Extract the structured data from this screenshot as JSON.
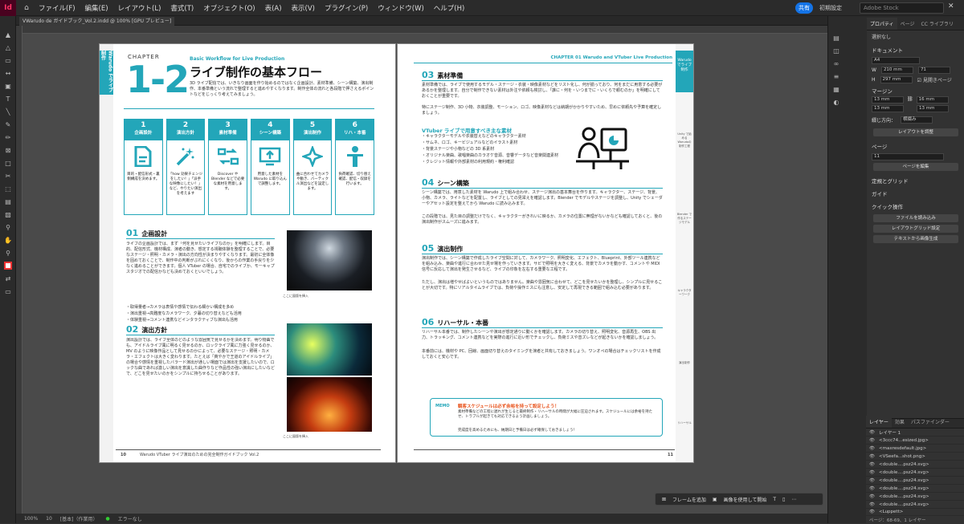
{
  "app": {
    "logo": "Id",
    "menu": [
      "ファイル(F)",
      "編集(E)",
      "レイアウト(L)",
      "書式(T)",
      "オブジェクト(O)",
      "表(A)",
      "表示(V)",
      "プラグイン(P)",
      "ウィンドウ(W)",
      "ヘルプ(H)"
    ],
    "share": "共有",
    "workspace": "初期設定",
    "search_placeholder": "Adobe Stock"
  },
  "document": {
    "tab": "VWarudo de ガイドブック_Vol.2.indd @ 100% [GPU プレビュー]"
  },
  "left_page": {
    "side_tab": "Warudo でライブ制作",
    "chapter": "CHAPTER",
    "number": "1-2",
    "subtitle": "Basic Workflow for Live Production",
    "title": "ライブ制作の基本フロー",
    "intro": "3D ライブ配信では、いきなり画面を作り始めるのではなく企画設計、素材準備、シーン構築、演出制作、本番準備という流れで整理すると進めやすくなります。制作全体の流れと各段階で押さえるポイントなどをじっくり考えてみましょう。",
    "steps": [
      {
        "n": "1",
        "t": "企画設計",
        "d": "目的・配信形式・裏側構成を決めます。"
      },
      {
        "n": "2",
        "t": "演出方針",
        "d": "「how 効果チェンジをしたい！」「派手な映像にしたい！」など、やりたい演出を考えます"
      },
      {
        "n": "3",
        "t": "素材準備",
        "d": "Discover や Blender などで必要な素材を用意します。"
      },
      {
        "n": "4",
        "t": "シーン構築",
        "d": "用意した素材を Warudo に取り込んで調整します。"
      },
      {
        "n": "5",
        "t": "演出制作",
        "d": "曲に合わせてカメラや動き、バーティクル演出などを設定します。"
      },
      {
        "n": "6",
        "t": "リハ・本番",
        "d": "負荷確認、切り替え確認、配信・収録を行います。"
      }
    ],
    "sec1": {
      "n": "01",
      "t": "企画設計",
      "body": "ライブの企画設計では、まず「何を見せたいライブなのか」を明確にします。目的、配信形式、機材構成、演者の動き、想定する視聴体験を整理することで、必要なステージ・照明・カメラ・演出の方向性が決まりやすくなります。最初に全体像を固めておくことで、制作中の判断がぶれにくくなり、後からの作業の手戻りを少なく進めることができます。個人 VTuber の場合、自宅でのライブか、モーキャプスタジオでの配信かなども決めておくといいでしょう。",
      "bullets": [
        "・取得量者→カメラは表情や感情で伝わる細かい構成を多め",
        "・演出重視→高難度なカメラワーク、夕暮の切り替えなども活用",
        "・体験重視→コメント連携などインタラクティブな演出も活用"
      ],
      "cap": "ここに図版を挿入"
    },
    "sec2": {
      "n": "02",
      "t": "演出方針",
      "body": "演出設計では、ライブ全体のどのような雰囲気で見せるかを決めます。明り物曲でも、アイドルライブ風に明るく見せるのか、ロックライブ風に力強く見せるのか、MV のように映像作品として見せるのかによって、必要なステージ・照明・カメラ・エフェクトは大きく変わります。たとえば「爽やかで王道のアイドルライブ」の場合や感情を重視したバラード演出が通しい場面では演出を支援したいので、ロックな曲であれば激しい演出を意識した曲作りなど作品性の強い演出にしたいなどで、どこを見せたいのかをシンプルに持ちせることがあります。",
      "cap": "ここに図版を挿入"
    },
    "footer": "Warudo VTuber ライブ演出のための完全制作ガイドブック Vol.2",
    "pagenum": "10"
  },
  "right_page": {
    "header": "CHAPTER 01  Warudo and VTuber Live Production",
    "side_tab": "Warudo でライブ制作",
    "side_labels": [
      "Unity で始めるWarudoの制作工程",
      "Blender で作るステージモデル",
      "キャラクターワーク",
      "演出制作",
      "リハーサル",
      "本番・アーカイブ"
    ],
    "sec3": {
      "n": "03",
      "t": "素材準備",
      "body": "素材準備では、ライブで使用するモデル・ステージ・衣装・映像素材などをリスト化し、何が揃っており、何をまだに用意する必要があるかを整理します。自分で制作できない素材は外注や依頼も検討し、「誰に・何を・いつまでに・いくらで頼むのか」を明確にしておくことが重要です。",
      "body2": "特にステージ制作、3D 小物、衣装調整、モーション、ロゴ、映像素材などは納期がかかりやすいため、早めに依頼先や予算を確定しましょう。"
    },
    "needed": {
      "title": "VTuber ライブで用意すべき主な素材",
      "items": [
        "・キャラクターモデルや衣装替えなどのキャラクター素材",
        "・サムネ、ロゴ、キービジュアルなどのイラスト素材",
        "・背景ステージや小物などの 3D 系素材",
        "・オリジナル楽曲、歌唱楽曲のカラオケ音源、音響データなど音楽関連素材",
        "・クレジット情報や外部素材の利用規約・権利確認"
      ]
    },
    "sec4": {
      "n": "04",
      "t": "シーン構築",
      "body": "シーン構築では、用意した素材を Warudo 上で組み合わせ、ステージ演出の基本舞台を作ります。キャラクター、ステージ、背景、小物、カメラ、ライトなどを配置し、ライブとしての見栄えを確認します。Blender でモデルやステージを調整し、Unity でシェーダーやアセット設定を整えてから Warudo に読み込みます。",
      "body2": "この段階では、見た目の調整だけでなく、キャラクターがきれいに映るか、カメラの位置に無理がないかなども確認しておくと、後の演出制作がスムーズに進みます。"
    },
    "sec5": {
      "n": "05",
      "t": "演出制作",
      "body": "演出制作では、シーン構築で作成したライブ空間に対して、カメラワーク、照明変化、エフェクト、Blueprint、外部ツール連携などを組み込み、楽曲や進行に合わせた見せ場を作っていきます。サビで照明を大きく変える、背景でカメラを動かす、コメントや MIDI 信号に反応して演出を発生させるなど、ライブの印象を左右する重要な工程です。",
      "body2": "ただし、演出は増やせばよいというものではありません。楽曲や雰囲気に合わせて、どこを見せたいかを整理し、シンプルに見せることが大切です。特にリアルタイムライブでは、負荷や操作ミスにも注意し、安定して再現できる範囲で組み込む必要があります。"
    },
    "sec6": {
      "n": "06",
      "t": "リハーサル・本番",
      "body": "リハーサル本番では、制作したシーンや演出が想定通りに動くかを確認します。カメラの切り替え、照明変化、音源再生、OBS 出力、トラッキング、コメント連携などを実際の進行に近い形でチェックし、負荷ミスや音ズレなどが起きないかを確認しましょう。",
      "body2": "本番前には、機材や PC、回線、画面切り替えのタイミングを演者と共有しておきましょう。ワンオペの場合はチェックリストを作成しておくと安心です。"
    },
    "memo": {
      "label": "MEMO",
      "title": "観客スケジュールは必ず余裕を持って設定しよう！",
      "body": "素材準備などの工程に遅れが生じると最終制作・リハーサルの時間が大幅に圧迫されます。スケジュールには余裕を持たせ、トラブルが起きても対応できるよう計画しましょう。",
      "note": "完成度を高めるためにも、納期日と予備日は必ず確保しておきましょう！"
    },
    "pagenum": "11"
  },
  "status": {
    "zoom": "100%",
    "page": "10",
    "view": "[基本]（作業用）",
    "errors": "エラーなし"
  },
  "floatbar": {
    "frame": "フレームを追加",
    "image": "画像を使用して開始"
  },
  "properties": {
    "tabs": [
      "プロパティ",
      "ページ",
      "CC ライブラリ"
    ],
    "selection": "選択なし",
    "document_label": "ドキュメント",
    "preset": "A4",
    "width": "210 mm",
    "height": "297 mm",
    "pages": "71",
    "facing": "見開きページ",
    "margin_label": "マージン",
    "m_top": "13 mm",
    "m_bottom": "13 mm",
    "m_left": "16 mm",
    "m_right": "13 mm",
    "binding_label": "綴じ方向：",
    "binding": "横綴み",
    "adjust_btn": "レイアウトを調整",
    "page_label": "ページ",
    "page_value": "11",
    "edit_page_btn": "ページを編集",
    "ruler_label": "定規とグリッド",
    "guide_label": "ガイド",
    "quick_label": "クイック操作",
    "q1": "ファイルを読み込み",
    "q2": "レイアウトグリッド設定",
    "q3": "テキストから画像生成"
  },
  "layers": {
    "tabs": [
      "レイヤー",
      "効果",
      "パスファインダー"
    ],
    "rows": [
      "レイヤー 1",
      "<3ccc74...esized.jpg>",
      "<maxresdefault.jpg>",
      "<VSeefa...shot.png>",
      "<double....psz24.svg>",
      "<double....psz24.svg>",
      "<double....psz24.svg>",
      "<double....psz24.svg>",
      "<double....psz24.svg>",
      "<double....psz24.svg>",
      "<Luppett>"
    ],
    "footer": "ページ：68-69、1 レイヤー"
  },
  "colors": {
    "accent": "#23a6b9",
    "brand": "#ff3366"
  }
}
